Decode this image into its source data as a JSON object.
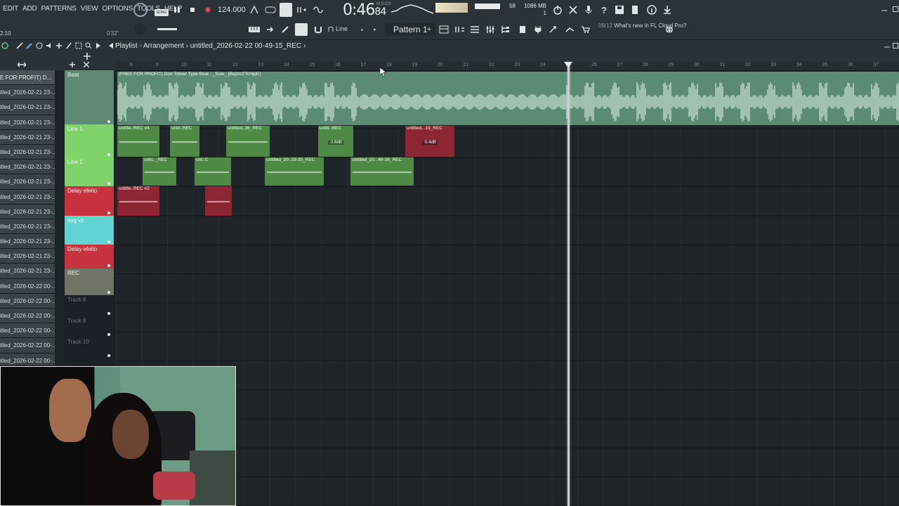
{
  "menu": [
    "EDIT",
    "ADD",
    "PATTERNS",
    "VIEW",
    "OPTIONS",
    "TOOLS",
    "HELP"
  ],
  "transport": {
    "song_badge": "SONG",
    "tempo": "124.000",
    "time_main": "0:46",
    "time_frac": "84",
    "time_format": "M:S:CS",
    "memory": "1086 MB",
    "voices": "1",
    "cpu": "58",
    "small_time": "0'32\"",
    "left_time": "2:10"
  },
  "toolbar": {
    "snap_label": "Line",
    "pattern_label": "Pattern 1",
    "news_date": "09/12",
    "news_text": "What's new in FL Cloud Pro?"
  },
  "playlist": {
    "title": "Playlist - Arrangement",
    "breadcrumb": "untitled_2026-02-22 00-49-15_REC",
    "ruler": [
      "8",
      "9",
      "10",
      "11",
      "12",
      "13",
      "14",
      "15",
      "16",
      "17",
      "18",
      "19",
      "20",
      "21",
      "22",
      "23",
      "24",
      "25",
      "26",
      "27",
      "28",
      "29",
      "30",
      "31",
      "32",
      "33",
      "34",
      "35",
      "36",
      "37"
    ]
  },
  "browser": [
    "E FOR PROFIT) D...",
    "itled_2026-02-21 23-...",
    "itled_2026-02-21 23-...",
    "itled_2026-02-21 23-...",
    "itled_2026-02-21 23-...",
    "itled_2026-02-21 23-...",
    "itled_2026-02-21 23-...",
    "itled_2026-02-21 23-...",
    "itled_2026-02-21 23-...",
    "itled_2026-02-21 23-...",
    "itled_2026-02-21 23-...",
    "itled_2026-02-21 23-...",
    "itled_2026-02-21 23-...",
    "itled_2026-02-21 23-...",
    "itled_2026-02-22 00-...",
    "itled_2026-02-22 00-...",
    "itled_2026-02-22 00-...",
    "itled_2026-02-22 00-...",
    "itled_2026-02-22 00-...",
    "itled_2026-02-22 00-..."
  ],
  "tracks": [
    {
      "name": "Beat",
      "color": "#5e8a75"
    },
    {
      "name": "Line 1",
      "color": "#7fd36a"
    },
    {
      "name": "Line 1",
      "color": "#7fd36a"
    },
    {
      "name": "Delay efeito",
      "color": "#c8323f"
    },
    {
      "name": "seg vz",
      "color": "#62d3d3"
    },
    {
      "name": "Delay efeito",
      "color": "#c8323f"
    },
    {
      "name": "REC",
      "color": "#6e7466"
    },
    {
      "name": "Track 8",
      "color": ""
    },
    {
      "name": "Track 9",
      "color": ""
    },
    {
      "name": "Track 10",
      "color": ""
    }
  ],
  "clips": {
    "beat": "(FREE FOR PROFIT) Don Toliver Type Beat - _Solo_ [Bq2m27KHjqE]",
    "line1a": [
      "untitle..REC #4",
      "untit..REC",
      "untitled..36_REC",
      "untitl..REC",
      "untitled...15_REC"
    ],
    "line1a_gains": [
      "-2.6dB",
      "-5.4dB"
    ],
    "line1b": [
      "untit.._REC",
      "unt..C",
      "untitled_20..33-35_REC",
      "untitled_20...46-26_REC"
    ],
    "delay": [
      "untitle..REC #2",
      ""
    ]
  },
  "colors": {
    "beat_clip": "#5b8b74",
    "line_clip": "#4e8a45",
    "line_clip_red": "#8c2632",
    "delay_clip": "#8c2632"
  }
}
